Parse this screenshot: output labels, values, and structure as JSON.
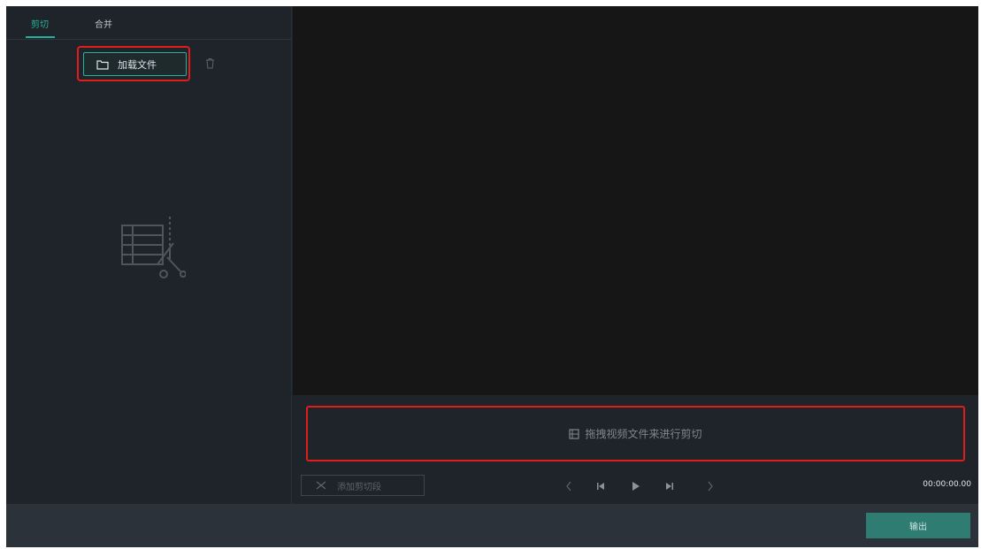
{
  "tabs": [
    {
      "label": "剪切",
      "active": true
    },
    {
      "label": "合并",
      "active": false
    }
  ],
  "sidebar": {
    "load_button_label": "加载文件",
    "load_icon": "folder-icon",
    "trash_icon": "trash-icon",
    "empty_icon": "film-scissors-icon"
  },
  "drop_area": {
    "text": "拖拽视频文件来进行剪切",
    "icon": "film-icon"
  },
  "controls": {
    "add_clip_label": "添加剪切段",
    "timecode": "00:00:00.00"
  },
  "footer": {
    "export_label": "输出"
  },
  "colors": {
    "accent": "#26b19b",
    "highlight": "#e21b1b",
    "panel_bg": "#1f242a",
    "preview_bg": "#161616",
    "export_bg": "#2f7c72"
  }
}
